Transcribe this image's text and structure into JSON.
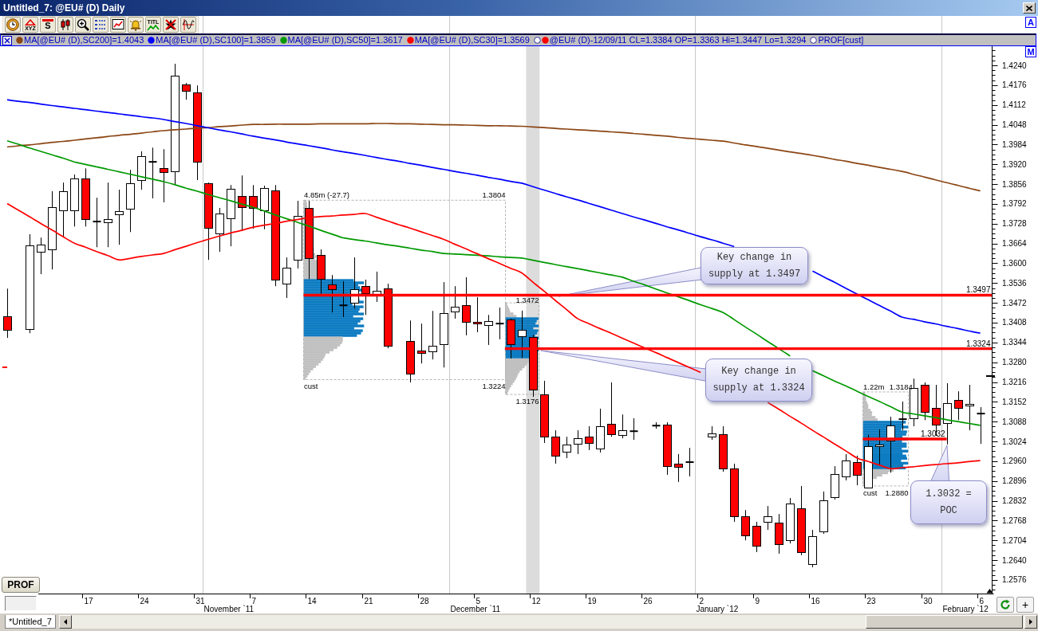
{
  "window": {
    "title": "Untitled_7: @EU# (D) Daily"
  },
  "toolbar": [
    {
      "kind": "clock"
    },
    {
      "kind": "drawing",
      "label": "XYZ"
    },
    {
      "kind": "symbol",
      "label": "S"
    },
    {
      "kind": "bars"
    },
    {
      "kind": "zoom"
    },
    {
      "kind": "list"
    },
    {
      "kind": "chart"
    },
    {
      "kind": "alert"
    },
    {
      "kind": "title",
      "label": "TITL"
    },
    {
      "kind": "delete"
    },
    {
      "kind": "wave"
    }
  ],
  "corner_buttons": [
    {
      "label": "A"
    },
    {
      "label": "M"
    }
  ],
  "legend": {
    "items": [
      {
        "kind": "line",
        "color": "#8b4513",
        "text": "MA[@EU# (D),SC200]=1.4043"
      },
      {
        "kind": "line",
        "color": "#0000ff",
        "text": "MA[@EU# (D),SC100]=1.3859"
      },
      {
        "kind": "line",
        "color": "#009900",
        "text": "MA[@EU# (D),SC50]=1.3617"
      },
      {
        "kind": "line",
        "color": "#ff0000",
        "text": "MA[@EU# (D),SC30]=1.3569"
      },
      {
        "kind": "candle",
        "color": "#ff0000",
        "text": "@EU# (D)-12/09/11 CL=1.3384 OP=1.3363 Hi=1.3447 Lo=1.3294"
      },
      {
        "kind": "profile",
        "text": "PROF[cust]"
      }
    ]
  },
  "chart": {
    "month_labels": [
      "November `11",
      "December `11",
      "January `12",
      "February `12"
    ],
    "chart_data": [
      {
        "type": "candlestick",
        "categories": [
          null,
          null,
          null,
          null,
          null,
          null,
          null,
          "17",
          null,
          null,
          null,
          null,
          "24",
          null,
          null,
          null,
          null,
          "31",
          null,
          null,
          null,
          null,
          "7",
          null,
          null,
          null,
          null,
          "14",
          null,
          null,
          null,
          null,
          "21",
          null,
          null,
          null,
          null,
          "28",
          null,
          null,
          null,
          null,
          "5",
          null,
          null,
          null,
          null,
          "12",
          null,
          null,
          null,
          null,
          "19",
          null,
          null,
          null,
          null,
          "26",
          null,
          null,
          null,
          null,
          "2",
          null,
          null,
          null,
          null,
          "9",
          null,
          null,
          null,
          null,
          "16",
          null,
          null,
          null,
          null,
          "23",
          null,
          null,
          null,
          null,
          "30",
          null,
          null,
          null,
          null,
          "6"
        ],
        "ohlc": [
          [
            1.3428,
            1.3518,
            1.3359,
            1.3385
          ],
          null,
          [
            1.3387,
            1.3694,
            1.3374,
            1.3658
          ],
          [
            1.3637,
            1.3683,
            1.3565,
            1.366
          ],
          [
            1.3645,
            1.3833,
            1.358,
            1.3781
          ],
          [
            1.3771,
            1.3861,
            1.3683,
            1.3833
          ],
          [
            1.3771,
            1.3887,
            1.3719,
            1.3874
          ],
          [
            1.3874,
            1.3907,
            1.3719,
            1.3743
          ],
          [
            1.3735,
            1.3812,
            1.3652,
            1.3735
          ],
          [
            1.3732,
            1.3861,
            1.3652,
            1.3743
          ],
          [
            1.3758,
            1.3838,
            1.366,
            1.3768
          ],
          [
            1.3776,
            1.3902,
            1.3701,
            1.3859
          ],
          [
            1.3869,
            1.3962,
            1.3838,
            1.3946
          ],
          [
            1.3928,
            1.3974,
            1.381,
            1.3928
          ],
          [
            1.3907,
            1.3969,
            1.3797,
            1.3895
          ],
          [
            1.3897,
            1.4245,
            1.3853,
            1.4206
          ],
          [
            1.4178,
            1.4183,
            1.4129,
            1.4157
          ],
          [
            1.4152,
            1.4175,
            1.3869,
            1.3928
          ],
          [
            1.3859,
            1.3861,
            1.3611,
            1.3714
          ],
          [
            1.3696,
            1.3779,
            1.3637,
            1.3761
          ],
          [
            1.3745,
            1.3853,
            1.3655,
            1.384
          ],
          [
            1.3817,
            1.3884,
            1.3704,
            1.3781
          ],
          [
            1.3817,
            1.3853,
            1.3712,
            1.3779
          ],
          [
            1.3771,
            1.3851,
            1.371,
            1.3843
          ],
          [
            1.3835,
            1.3853,
            1.3526,
            1.3547
          ],
          [
            1.3534,
            1.3619,
            1.3488,
            1.3585
          ],
          [
            1.3611,
            1.3802,
            1.3583,
            1.3753
          ],
          [
            1.3779,
            1.3802,
            1.3549,
            1.3616
          ],
          [
            1.3627,
            1.3645,
            1.35,
            1.3549
          ],
          [
            1.3531,
            1.3562,
            1.3441,
            1.3516
          ],
          [
            1.3464,
            1.3542,
            1.3426,
            1.3464
          ],
          [
            1.3472,
            1.3619,
            1.3454,
            1.3516
          ],
          [
            1.3526,
            1.3547,
            1.3433,
            1.3503
          ],
          [
            1.3495,
            1.3573,
            1.3475,
            1.3511
          ],
          [
            1.3518,
            1.3534,
            1.3325,
            1.3333
          ],
          null,
          [
            1.3348,
            1.3415,
            1.3215,
            1.3243
          ],
          [
            1.3318,
            1.3405,
            1.3276,
            1.331
          ],
          [
            1.3315,
            1.3446,
            1.3289,
            1.3333
          ],
          [
            1.3338,
            1.3539,
            1.3263,
            1.3439
          ],
          [
            1.3444,
            1.3526,
            1.3421,
            1.3459
          ],
          [
            1.3464,
            1.3555,
            1.3367,
            1.341
          ],
          [
            1.341,
            1.349,
            1.3377,
            1.3405
          ],
          [
            1.34,
            1.3433,
            1.3336,
            1.3413
          ],
          [
            1.3405,
            1.3457,
            1.3354,
            1.3405
          ],
          [
            1.3418,
            1.3421,
            1.3292,
            1.3338
          ],
          [
            1.3363,
            1.3447,
            1.3294,
            1.3384
          ],
          [
            1.3361,
            1.3369,
            1.3168,
            1.3191
          ],
          [
            1.3176,
            1.322,
            1.3019,
            1.3039
          ],
          [
            1.3039,
            1.306,
            1.2952,
            1.2978
          ],
          [
            1.299,
            1.3039,
            1.297,
            1.3014
          ],
          [
            1.3016,
            1.306,
            1.2983,
            1.3034
          ],
          [
            1.3039,
            1.3073,
            1.2996,
            1.3019
          ],
          [
            1.3001,
            1.313,
            1.2988,
            1.3073
          ],
          [
            1.3081,
            1.3215,
            1.3039,
            1.3047
          ],
          [
            1.3045,
            1.3111,
            1.3034,
            1.306
          ],
          [
            1.3057,
            1.3099,
            1.3029,
            1.3057
          ],
          null,
          [
            1.3075,
            1.3086,
            1.3065,
            1.3075
          ],
          [
            1.3078,
            1.3086,
            1.2916,
            1.2944
          ],
          [
            1.2952,
            1.2983,
            1.2893,
            1.2941
          ],
          [
            1.2957,
            1.3003,
            1.2911,
            1.2957
          ],
          null,
          [
            1.3039,
            1.3073,
            1.3029,
            1.305
          ],
          [
            1.3047,
            1.3073,
            1.2926,
            1.2936
          ],
          [
            1.2936,
            1.2952,
            1.2764,
            1.2782
          ],
          [
            1.2782,
            1.2802,
            1.2704,
            1.272
          ],
          [
            1.2751,
            1.2764,
            1.2666,
            1.2686
          ],
          [
            1.2764,
            1.2815,
            1.2738,
            1.2782
          ],
          [
            1.2761,
            1.2789,
            1.2661,
            1.2692
          ],
          [
            1.2704,
            1.2841,
            1.2694,
            1.2823
          ],
          [
            1.2808,
            1.288,
            1.2656,
            1.2666
          ],
          [
            1.2627,
            1.2738,
            1.2617,
            1.2717
          ],
          [
            1.2733,
            1.2862,
            1.2725,
            1.2833
          ],
          [
            1.2844,
            1.2944,
            1.2836,
            1.2918
          ],
          [
            1.2911,
            1.2983,
            1.2898,
            1.2962
          ],
          [
            1.2957,
            1.2978,
            1.2882,
            1.2916
          ],
          [
            1.2874,
            1.3045,
            1.2872,
            1.3008
          ],
          [
            1.3008,
            1.3063,
            1.2949,
            1.3014
          ],
          [
            1.3026,
            1.3104,
            1.2923,
            1.3075
          ],
          [
            1.3096,
            1.3153,
            1.306,
            1.3096
          ],
          [
            1.3099,
            1.3227,
            1.3073,
            1.3196
          ],
          [
            1.3207,
            1.3215,
            1.3093,
            1.3119
          ],
          [
            1.3132,
            1.3207,
            1.3042,
            1.3078
          ],
          [
            1.3083,
            1.3212,
            1.3014,
            1.3148
          ],
          [
            1.3158,
            1.3186,
            1.3093,
            1.3132
          ],
          [
            1.314,
            1.3207,
            1.306,
            1.3145
          ],
          [
            1.3114,
            1.3135,
            1.3016,
            1.3114
          ]
        ],
        "series": [
          {
            "type": "line",
            "color": "#8b4513",
            "values": [
              1.3976,
              1.398,
              1.3983,
              1.3987,
              1.3991,
              1.3994,
              1.3998,
              1.4002,
              1.4006,
              1.401,
              1.4014,
              1.4017,
              1.4021,
              1.4025,
              1.4029,
              1.4032,
              1.4034,
              1.4037,
              1.4039,
              1.4042,
              1.4044,
              1.4047,
              1.4049,
              1.4049,
              1.405,
              1.405,
              1.405,
              1.405,
              1.4051,
              1.4051,
              1.4051,
              1.4051,
              1.4051,
              1.4052,
              1.4052,
              1.4051,
              1.4051,
              1.405,
              1.4049,
              1.4048,
              1.4048,
              1.4047,
              1.4046,
              1.4045,
              1.4045,
              1.4044,
              1.4043,
              1.4041,
              1.4039,
              1.4036,
              1.4034,
              1.4032,
              1.403,
              1.4027,
              1.4025,
              1.4023,
              1.402,
              1.4017,
              1.4014,
              1.4011,
              1.4007,
              1.4004,
              1.4001,
              1.3998,
              1.3995,
              1.3989,
              1.3983,
              1.3978,
              1.3972,
              1.3966,
              1.396,
              1.3955,
              1.3949,
              1.3943,
              1.3936,
              1.393,
              1.3923,
              1.3917,
              1.391,
              1.3904,
              1.3897,
              1.3888,
              1.3879,
              1.387,
              1.3861,
              1.3852,
              1.3843,
              1.3834
            ]
          },
          {
            "type": "line",
            "color": "#0000ff",
            "values": [
              1.4129,
              1.4124,
              1.412,
              1.4115,
              1.411,
              1.4106,
              1.4101,
              1.4097,
              1.4092,
              1.4088,
              1.4083,
              1.4079,
              1.4074,
              1.407,
              1.4065,
              1.4058,
              1.4052,
              1.4045,
              1.4038,
              1.4031,
              1.4025,
              1.4018,
              1.4011,
              1.4005,
              1.3999,
              1.3992,
              1.3986,
              1.398,
              1.3974,
              1.3967,
              1.3961,
              1.3955,
              1.3949,
              1.3942,
              1.3936,
              1.393,
              1.3923,
              1.3917,
              1.391,
              1.3904,
              1.3897,
              1.3891,
              1.3885,
              1.3878,
              1.3872,
              1.3865,
              1.3859,
              1.3848,
              1.3837,
              1.3826,
              1.3815,
              1.3805,
              1.3794,
              1.3783,
              1.3772,
              1.3761,
              1.375,
              1.374,
              1.3729,
              1.3718,
              1.3708,
              1.3697,
              1.3686,
              1.3676,
              1.3665,
              1.3654,
              null,
              null,
              null,
              null,
              null,
              null,
              1.3575,
              1.3556,
              1.3538,
              1.3519,
              1.35,
              1.3482,
              1.3463,
              1.3445,
              1.3426,
              1.3419,
              1.3411,
              1.3404,
              1.3396,
              1.3389,
              1.3381,
              1.3374
            ]
          },
          {
            "type": "line",
            "color": "#009900",
            "values": [
              1.3996,
              1.3985,
              1.3973,
              1.3962,
              1.3951,
              1.394,
              1.3928,
              1.392,
              1.3912,
              1.3904,
              1.3896,
              1.3888,
              1.388,
              1.3872,
              1.3864,
              1.3854,
              1.3843,
              1.3833,
              1.3822,
              1.3812,
              1.3802,
              1.3791,
              1.3781,
              1.3769,
              1.3756,
              1.3744,
              1.3732,
              1.372,
              1.3707,
              1.3695,
              1.3683,
              1.3677,
              1.3672,
              1.3666,
              1.366,
              1.3655,
              1.3649,
              1.3643,
              1.3638,
              1.3632,
              1.363,
              1.3628,
              1.3626,
              1.3624,
              1.3621,
              1.3619,
              1.3617,
              1.361,
              1.3603,
              1.3596,
              1.3589,
              1.3583,
              1.3576,
              1.3569,
              1.3562,
              1.3555,
              1.3542,
              1.353,
              1.3517,
              1.3504,
              1.3492,
              1.3479,
              1.3466,
              1.3454,
              1.3441,
              1.3418,
              1.3394,
              1.3371,
              1.3347,
              1.3324,
              1.33,
              null,
              1.3253,
              1.3236,
              1.3219,
              1.3203,
              1.3186,
              1.3169,
              1.3153,
              1.3136,
              1.3119,
              1.3113,
              1.3107,
              1.3101,
              1.3094,
              1.3088,
              1.3082,
              1.3076
            ]
          },
          {
            "type": "line",
            "color": "#ff0000",
            "values": [
              1.3793,
              1.3772,
              1.3751,
              1.3729,
              1.3708,
              1.3686,
              1.3665,
              1.3652,
              1.3638,
              1.3625,
              1.3611,
              1.3616,
              1.3622,
              1.3627,
              1.3632,
              1.3644,
              1.3655,
              1.3667,
              1.3678,
              1.3688,
              1.3698,
              1.3707,
              1.3717,
              1.3723,
              1.3729,
              1.3736,
              1.3742,
              1.3748,
              1.3751,
              1.3753,
              1.3756,
              1.3758,
              1.3761,
              1.3749,
              1.3737,
              1.3725,
              1.3714,
              1.3702,
              1.369,
              1.3678,
              1.3662,
              1.3647,
              1.3631,
              1.3615,
              1.36,
              1.3584,
              1.3569,
              1.3539,
              1.351,
              1.348,
              1.3451,
              1.3421,
              1.3405,
              1.3389,
              1.3374,
              1.3358,
              1.3342,
              1.3326,
              1.3311,
              1.3295,
              1.3279,
              1.3263,
              1.3247,
              null,
              null,
              null,
              null,
              null,
              1.315,
              1.3128,
              1.3105,
              1.3083,
              1.306,
              1.3038,
              1.3015,
              1.2993,
              1.297,
              1.2959,
              1.2947,
              1.2936,
              1.2939,
              1.2942,
              1.2946,
              1.2949,
              1.2952,
              1.2955,
              1.2959,
              1.2962
            ]
          }
        ],
        "ylim": [
          1.2532,
          1.4302
        ],
        "yticks": [
          1.2576,
          {
            "value": 1.264,
            "label": "1.2640"
          },
          1.2704,
          1.2768,
          1.2832,
          1.2896,
          {
            "value": 1.296,
            "label": "1.2960"
          },
          1.3024,
          1.3088,
          1.3152,
          1.3216,
          {
            "value": 1.328,
            "label": "1.3280"
          },
          1.3344,
          1.3408,
          1.3472,
          1.3536,
          {
            "value": 1.36,
            "label": "1.3600"
          },
          1.3664,
          1.3728,
          1.3792,
          1.3856,
          {
            "value": 1.392,
            "label": "1.3920"
          },
          1.3984,
          1.4048,
          1.4112,
          1.4176,
          {
            "value": 1.424,
            "label": "1.4240"
          }
        ],
        "ref_lines": [
          {
            "axis": "y",
            "value": 1.3497,
            "label": "1.3497",
            "color": "#ff0000"
          },
          {
            "axis": "y",
            "value": 1.3324,
            "label": "1.3324",
            "color": "#ff0000"
          },
          {
            "axis": "y",
            "value": 1.3032,
            "label": "1.3032",
            "color": "#ff0000"
          }
        ],
        "annotations": [
          "4.85m (-27.7)",
          "1.3804",
          "cust",
          "1.3224",
          "1.3472",
          "1.3176",
          "1.22m",
          "1.3184",
          "cust",
          "1.2880",
          "Key change in supply at 1.3497",
          "Key change in supply at 1.3324",
          "1.3032 = POC"
        ]
      }
    ]
  },
  "prof_button": {
    "label": "PROF"
  },
  "axis_buttons": [
    {
      "kind": "refresh"
    },
    {
      "kind": "add",
      "label": "+"
    }
  ],
  "tabs": [
    {
      "label": "*Untitled_7",
      "selected": true
    }
  ]
}
